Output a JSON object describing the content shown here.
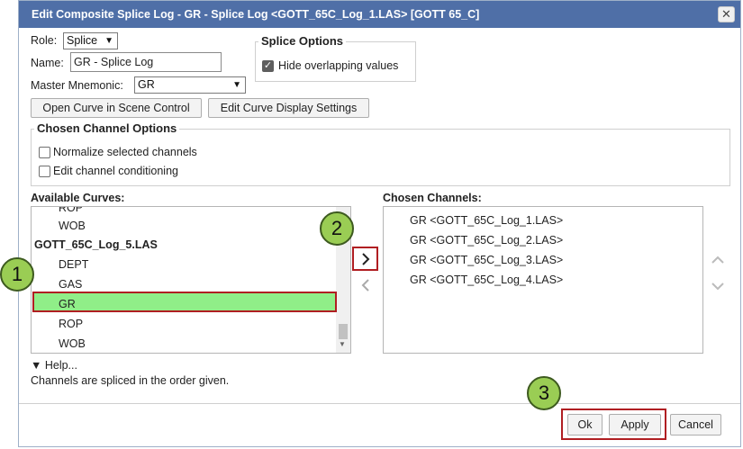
{
  "dialog": {
    "title": "Edit Composite Splice Log - GR - Splice Log <GOTT_65C_Log_1.LAS> [GOTT 65_C]",
    "close_glyph": "✕"
  },
  "form": {
    "role_label": "Role:",
    "role_value": "Splice",
    "name_label": "Name:",
    "name_value": "GR - Splice Log",
    "master_label": "Master Mnemonic:",
    "master_value": "GR"
  },
  "splice_options": {
    "title": "Splice Options",
    "hide_overlapping_label": "Hide overlapping values",
    "hide_overlapping_checked": true
  },
  "buttons": {
    "open_curve": "Open Curve in Scene Control",
    "edit_curve_display": "Edit Curve Display Settings",
    "ok": "Ok",
    "apply": "Apply",
    "cancel": "Cancel"
  },
  "chosen_channel_options": {
    "title": "Chosen Channel Options",
    "normalize_label": "Normalize selected channels",
    "normalize_checked": false,
    "conditioning_label": "Edit channel conditioning",
    "conditioning_checked": false
  },
  "available": {
    "header": "Available Curves:",
    "items": [
      {
        "text": "ROP",
        "group": false,
        "selected": false
      },
      {
        "text": "WOB",
        "group": false,
        "selected": false
      },
      {
        "text": "GOTT_65C_Log_5.LAS",
        "group": true,
        "selected": false
      },
      {
        "text": "DEPT",
        "group": false,
        "selected": false
      },
      {
        "text": "GAS",
        "group": false,
        "selected": false
      },
      {
        "text": "GR",
        "group": false,
        "selected": true
      },
      {
        "text": "ROP",
        "group": false,
        "selected": false
      },
      {
        "text": "WOB",
        "group": false,
        "selected": false
      }
    ]
  },
  "chosen": {
    "header": "Chosen Channels:",
    "items": [
      "GR <GOTT_65C_Log_1.LAS>",
      "GR <GOTT_65C_Log_2.LAS>",
      "GR <GOTT_65C_Log_3.LAS>",
      "GR <GOTT_65C_Log_4.LAS>"
    ]
  },
  "help": {
    "toggle": "▼ Help...",
    "text": "Channels are spliced in the order given."
  },
  "callouts": [
    "1",
    "2",
    "3"
  ],
  "colors": {
    "titlebar": "#4f6fa7",
    "selected_row": "#90ee88",
    "highlight_border": "#b01e22",
    "callout_fill": "#9acd54"
  },
  "icons": {
    "add": "chevron-right-icon",
    "remove": "chevron-left-icon",
    "up": "chevron-up-icon",
    "down": "chevron-down-icon"
  }
}
